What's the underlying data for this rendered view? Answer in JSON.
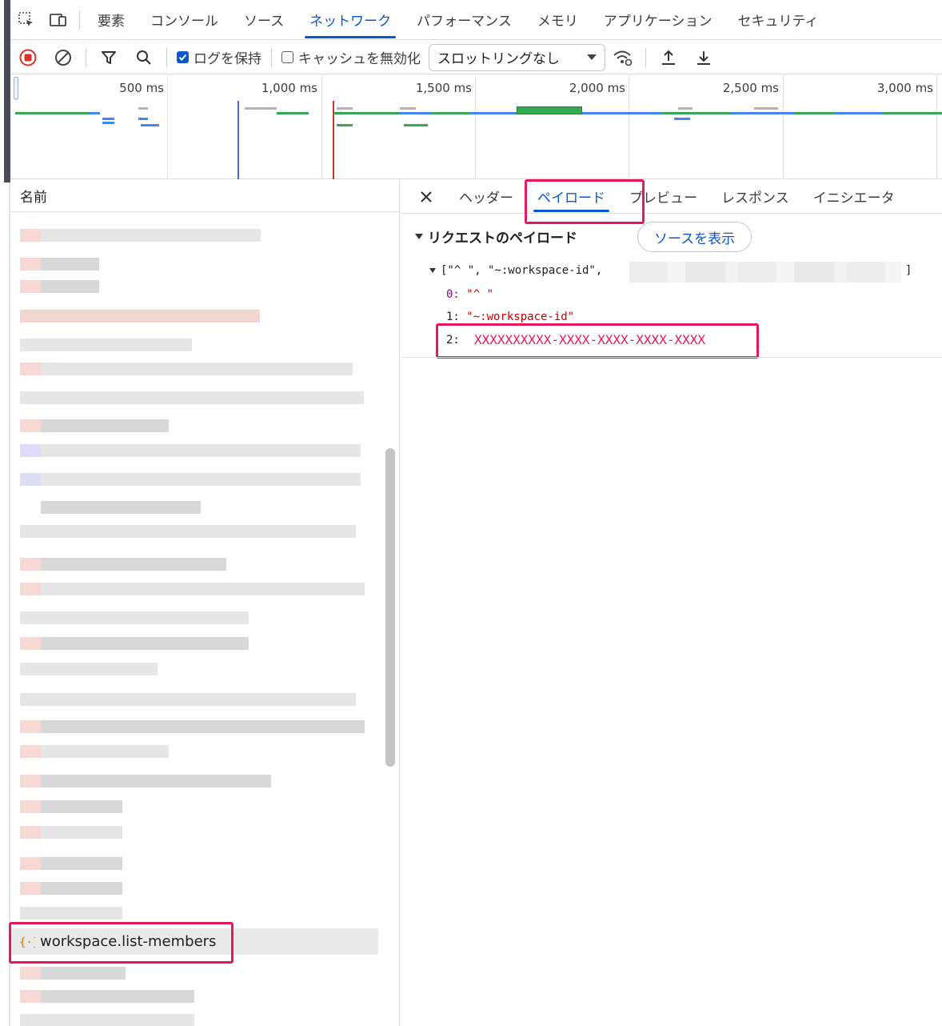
{
  "devtools": {
    "main_tabs": [
      "要素",
      "コンソール",
      "ソース",
      "ネットワーク",
      "パフォーマンス",
      "メモリ",
      "アプリケーション",
      "セキュリティ"
    ],
    "active_main_tab": "ネットワーク"
  },
  "toolbar": {
    "preserve_log_label": "ログを保持",
    "disable_cache_label": "キャッシュを無効化",
    "throttling_value": "スロットリングなし"
  },
  "overview": {
    "ticks": [
      "500 ms",
      "1,000 ms",
      "1,500 ms",
      "2,000 ms",
      "2,500 ms",
      "3,000 ms"
    ]
  },
  "names_panel": {
    "header": "名前",
    "selected_request": "workspace.list-members"
  },
  "details": {
    "tabs": [
      "ヘッダー",
      "ペイロード",
      "プレビュー",
      "レスポンス",
      "イニシエータ"
    ],
    "active_tab": "ペイロード",
    "section_title": "リクエストのペイロード",
    "view_source_button": "ソースを表示",
    "payload_summary": "[\"^ \", \"~:workspace-id\",",
    "payload_close": "]",
    "items": [
      {
        "key": "0:",
        "value": "\"^ \""
      },
      {
        "key": "1:",
        "value": "\"~:workspace-id\""
      },
      {
        "key": "2:",
        "value": "XXXXXXXXXX-XXXX-XXXX-XXXX-XXXX"
      }
    ]
  },
  "colors": {
    "accent": "#0b57d0",
    "highlight": "#e8175d",
    "record_red": "#d93025",
    "timeline_green": "#34a853",
    "timeline_blue": "#4285f4"
  }
}
